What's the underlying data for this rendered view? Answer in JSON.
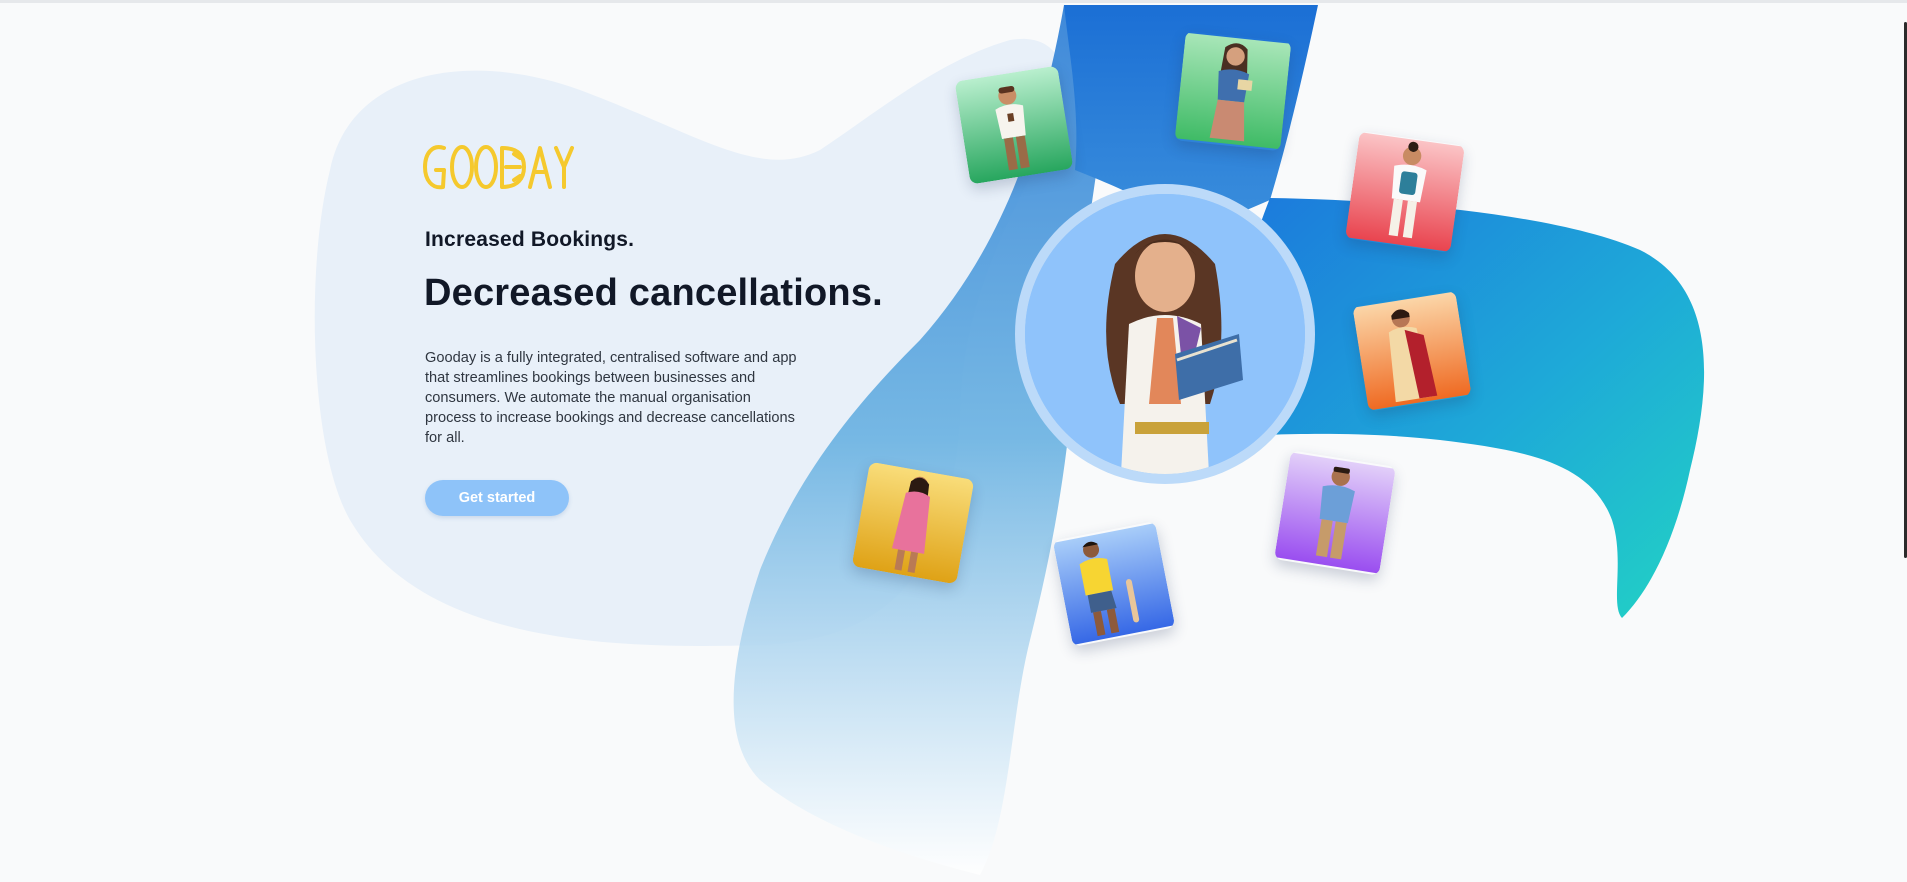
{
  "brand": {
    "logo_text": "GOODAY",
    "logo_color": "#f5c92d"
  },
  "hero": {
    "subheading": "Increased Bookings.",
    "heading": "Decreased cancellations.",
    "description": "Gooday is a fully integrated, centralised software and app that streamlines bookings between businesses and consumers. We automate the manual organisation process to increase bookings and decrease cancellations for all.",
    "cta_label": "Get started"
  },
  "colors": {
    "page_background": "#f9fafb",
    "blob": "#e8f0f9",
    "ribbon_blue": "#1f7fdd",
    "ribbon_teal": "#22d3c4",
    "cta": "#8ec3f9",
    "text_dark": "#111827"
  },
  "avatars": [
    {
      "name": "man-glasses-coffee-avatar",
      "tile_color": "#34b36b"
    },
    {
      "name": "woman-books-avatar",
      "tile_color": "#4cc46f"
    },
    {
      "name": "man-backpack-avatar",
      "tile_color": "#f0606a"
    },
    {
      "name": "woman-saree-avatar",
      "tile_color": "#f58a2e"
    },
    {
      "name": "man-blue-shirt-avatar",
      "tile_color": "#a35cf0"
    },
    {
      "name": "boy-yellow-shirt-avatar",
      "tile_color": "#3f7ff0"
    },
    {
      "name": "woman-pink-dress-avatar",
      "tile_color": "#f2c22e"
    },
    {
      "name": "teacher-woman-avatar",
      "tile_color": "#8fc3fb"
    }
  ]
}
